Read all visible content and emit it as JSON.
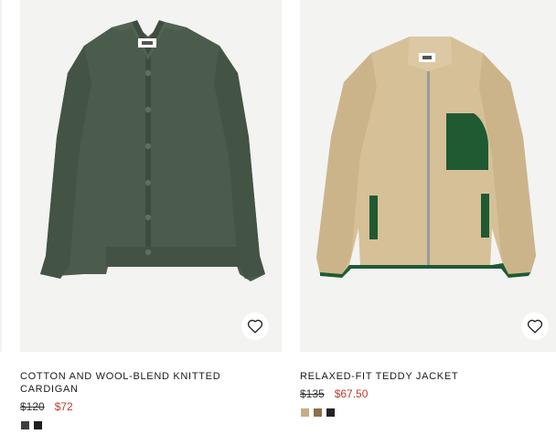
{
  "products": [
    {
      "name": "COTTON AND WOOL-BLEND KNITTED CARDIGAN",
      "original_price": "$120",
      "sale_price": "$72",
      "image_icon": "cardigan-image",
      "wishlist_icon": "heart-icon",
      "swatches": [
        {
          "color": "#3c3f42"
        },
        {
          "color": "#1e1e1e"
        }
      ]
    },
    {
      "name": "RELAXED-FIT TEDDY JACKET",
      "original_price": "$135",
      "sale_price": "$67.50",
      "image_icon": "teddy-jacket-image",
      "wishlist_icon": "heart-icon",
      "swatches": [
        {
          "color": "#c8ad84"
        },
        {
          "color": "#8c6f4e"
        },
        {
          "color": "#222222"
        }
      ]
    }
  ],
  "colors": {
    "sale": "#c0392b",
    "image_bg": "#f3f3f2",
    "cardigan": "#4a5a4c",
    "teddy": "#d8c39c",
    "teddy_trim": "#1f5a33"
  }
}
